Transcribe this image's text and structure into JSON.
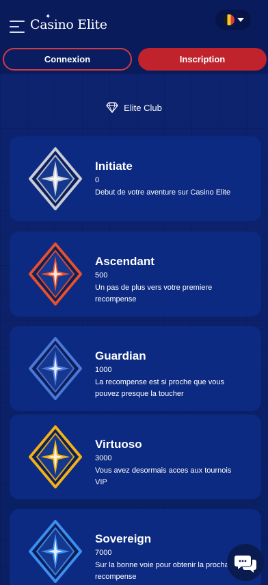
{
  "header": {
    "logo_text": "Casino Elite",
    "language_flag": "Belgium",
    "menu_icon": "hamburger-icon"
  },
  "auth": {
    "login_label": "Connexion",
    "signup_label": "Inscription"
  },
  "club": {
    "title": "Elite Club",
    "icon": "diamond-icon"
  },
  "levels": [
    {
      "name": "Initiate",
      "points": "0",
      "description": "Debut de votre aventure sur Casino Elite",
      "color": "#c7ccd6"
    },
    {
      "name": "Ascendant",
      "points": "500",
      "description": "Un pas de plus vers votre premiere recompense",
      "color": "#e8502e"
    },
    {
      "name": "Guardian",
      "points": "1000",
      "description": "La recompense est si proche que vous pouvez presque la toucher",
      "color": "#4b78d8"
    },
    {
      "name": "Virtuoso",
      "points": "3000",
      "description": "Vous avez desormais acces aux tournois VIP",
      "color": "#f2b217"
    },
    {
      "name": "Sovereign",
      "points": "7000",
      "description": "Sur la bonne voie pour obtenir la prochaine recompense",
      "color": "#3b8ff0"
    }
  ],
  "colors": {
    "background": "#0a1f63",
    "card": "#0c2a82",
    "accent_red": "#c0232c"
  }
}
